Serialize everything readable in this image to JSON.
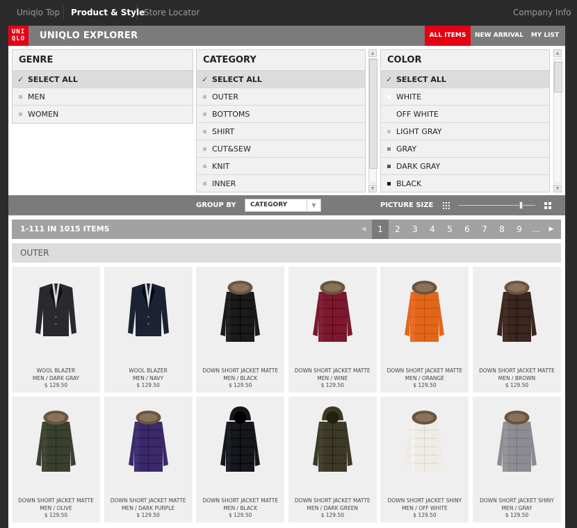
{
  "topnav": {
    "items": [
      "Uniqlo Top",
      "Product & Style",
      "Store Locator"
    ],
    "right": "Company Info"
  },
  "header": {
    "logo": [
      "UNI",
      "QLO"
    ],
    "title": "UNIQLO EXPLORER",
    "tabs": [
      "ALL ITEMS",
      "NEW ARRIVAL",
      "MY LIST"
    ],
    "active_tab": "ALL ITEMS"
  },
  "filters": {
    "genre": {
      "title": "GENRE",
      "items": [
        "SELECT ALL",
        "MEN",
        "WOMEN"
      ]
    },
    "category": {
      "title": "CATEGORY",
      "items": [
        "SELECT ALL",
        "OUTER",
        "BOTTOMS",
        "SHIRT",
        "CUT&SEW",
        "KNIT",
        "INNER"
      ]
    },
    "color": {
      "title": "COLOR",
      "items": [
        "SELECT ALL",
        "WHITE",
        "OFF WHITE",
        "LIGHT GRAY",
        "GRAY",
        "DARK GRAY",
        "BLACK"
      ],
      "swatches": [
        "",
        "#ffffff",
        "#f5f2e8",
        "#c4c4c4",
        "#8a8a8a",
        "#555555",
        "#111111"
      ]
    }
  },
  "toolbar": {
    "group_by_label": "GROUP BY",
    "group_by_value": "CATEGORY",
    "picture_size_label": "PICTURE SIZE",
    "picture_size_level": 0.82
  },
  "results": {
    "count": "1-111 IN 1015 ITEMS",
    "pages": [
      "1",
      "2",
      "3",
      "4",
      "5",
      "6",
      "7",
      "8",
      "9",
      "..."
    ],
    "current_page": "1",
    "section": "OUTER"
  },
  "products": [
    {
      "name": "WOOL BLAZER",
      "sub": "MEN / DARK GRAY",
      "price": "$  129.50",
      "kind": "blazer",
      "color": "#2a2a2e"
    },
    {
      "name": "WOOL BLAZER",
      "sub": "MEN / NAVY",
      "price": "$  129.50",
      "kind": "blazer",
      "color": "#1c2233"
    },
    {
      "name": "DOWN SHORT JACKET MATTE",
      "sub": "MEN / BLACK",
      "price": "$  129.50",
      "kind": "fur",
      "color": "#1a1a1a"
    },
    {
      "name": "DOWN SHORT JACKET MATTE",
      "sub": "MEN / WINE",
      "price": "$  129.50",
      "kind": "fur",
      "color": "#7a1830"
    },
    {
      "name": "DOWN SHORT JACKET MATTE",
      "sub": "MEN / ORANGE",
      "price": "$  129.50",
      "kind": "fur",
      "color": "#e0661c"
    },
    {
      "name": "DOWN SHORT JACKET MATTE",
      "sub": "MEN / BROWN",
      "price": "$  129.50",
      "kind": "fur",
      "color": "#3b2720"
    },
    {
      "name": "DOWN SHORT JACKET MATTE",
      "sub": "MEN / OLIVE",
      "price": "$  129.50",
      "kind": "fur",
      "color": "#3a4030"
    },
    {
      "name": "DOWN SHORT JACKET MATTE",
      "sub": "MEN / DARK PURPLE",
      "price": "$  129.50",
      "kind": "fur",
      "color": "#3a2a6a"
    },
    {
      "name": "DOWN SHORT JACKET MATTE",
      "sub": "MEN / BLACK",
      "price": "$  129.50",
      "kind": "hood",
      "color": "#15171c"
    },
    {
      "name": "DOWN SHORT JACKET MATTE",
      "sub": "MEN / DARK GREEN",
      "price": "$  129.50",
      "kind": "hood",
      "color": "#3c3a26"
    },
    {
      "name": "DOWN SHORT JACKET SHINY",
      "sub": "MEN / OFF WHITE",
      "price": "$  129.50",
      "kind": "fur",
      "color": "#efece6"
    },
    {
      "name": "DOWN SHORT JACKET SHINY",
      "sub": "MEN / GRAY",
      "price": "$  129.50",
      "kind": "fur",
      "color": "#8c8d92"
    }
  ]
}
